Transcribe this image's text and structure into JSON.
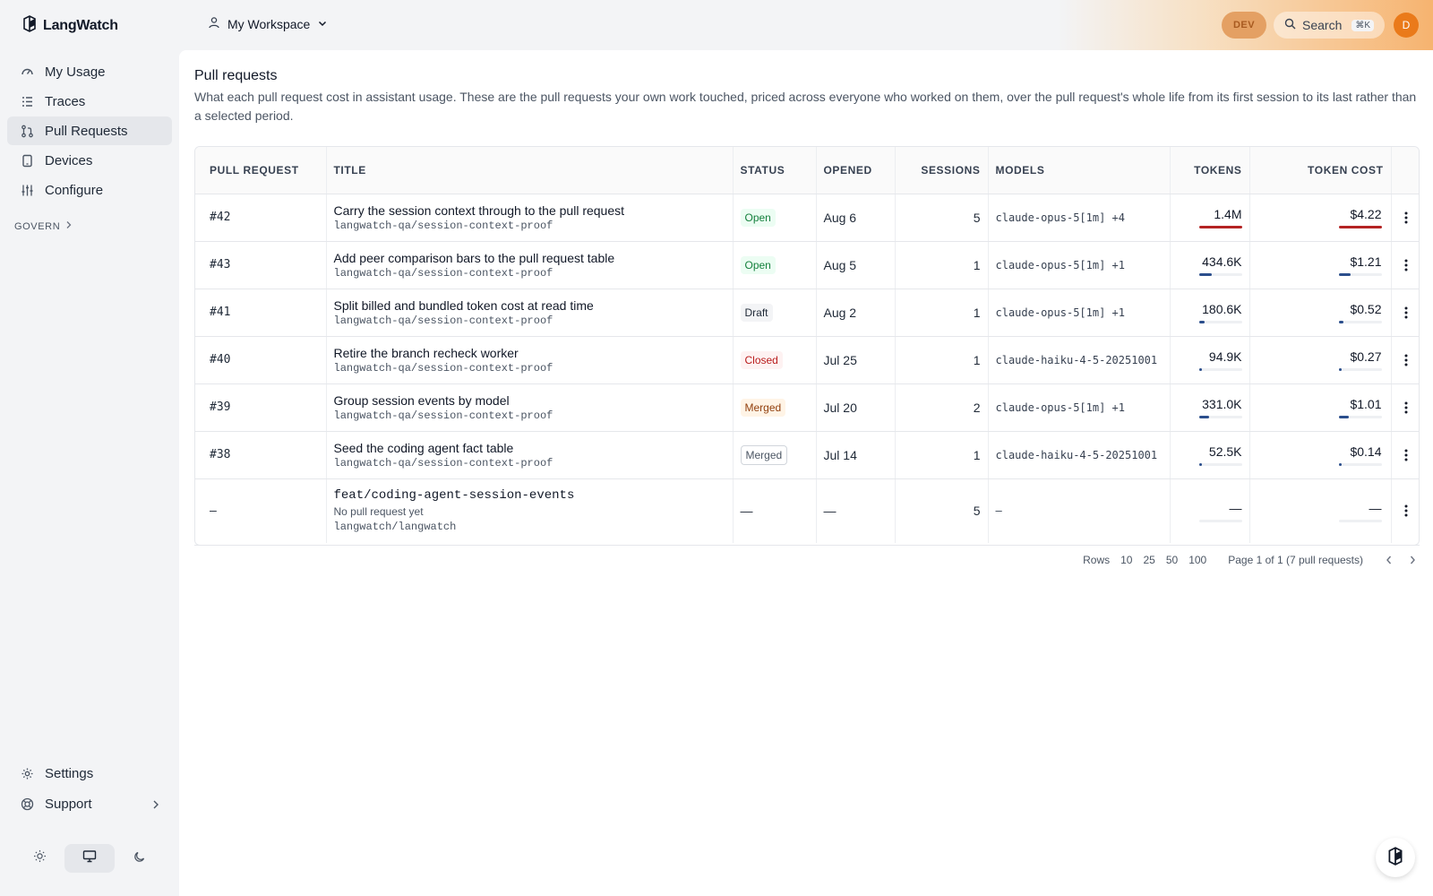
{
  "app": {
    "name": "LangWatch"
  },
  "header": {
    "workspace": "My Workspace",
    "env_badge": "DEV",
    "search_label": "Search",
    "search_shortcut": "⌘K",
    "avatar_initial": "D",
    "accent_color": "#f7a858"
  },
  "sidebar": {
    "items": [
      {
        "label": "My Usage",
        "icon": "gauge-icon"
      },
      {
        "label": "Traces",
        "icon": "list-icon"
      },
      {
        "label": "Pull Requests",
        "icon": "git-pull-request-icon",
        "active": true
      },
      {
        "label": "Devices",
        "icon": "tablet-icon"
      },
      {
        "label": "Configure",
        "icon": "sliders-icon"
      }
    ],
    "section": "GOVERN",
    "bottom": [
      {
        "label": "Settings",
        "icon": "gear-icon"
      },
      {
        "label": "Support",
        "icon": "lifebuoy-icon"
      }
    ]
  },
  "page": {
    "title": "Pull requests",
    "description": "What each pull request cost in assistant usage. These are the pull requests your own work touched, priced across everyone who worked on them, over the pull request's whole life from its first session to its last rather than a selected period."
  },
  "table": {
    "columns": [
      "PULL REQUEST",
      "TITLE",
      "STATUS",
      "OPENED",
      "SESSIONS",
      "MODELS",
      "TOKENS",
      "TOKEN COST"
    ],
    "rows": [
      {
        "pr": "#42",
        "title": "Carry the session context through to the pull request",
        "repo": "langwatch-qa/session-context-proof",
        "status": "Open",
        "opened": "Aug 6",
        "sessions": "5",
        "models": "claude-opus-5[1m] +4",
        "tokens": "1.4M",
        "tokens_frac": 1.0,
        "cost": "$4.22",
        "cost_frac": 1.0
      },
      {
        "pr": "#43",
        "title": "Add peer comparison bars to the pull request table",
        "repo": "langwatch-qa/session-context-proof",
        "status": "Open",
        "opened": "Aug 5",
        "sessions": "1",
        "models": "claude-opus-5[1m] +1",
        "tokens": "434.6K",
        "tokens_frac": 0.31,
        "cost": "$1.21",
        "cost_frac": 0.29
      },
      {
        "pr": "#41",
        "title": "Split billed and bundled token cost at read time",
        "repo": "langwatch-qa/session-context-proof",
        "status": "Draft",
        "opened": "Aug 2",
        "sessions": "1",
        "models": "claude-opus-5[1m] +1",
        "tokens": "180.6K",
        "tokens_frac": 0.13,
        "cost": "$0.52",
        "cost_frac": 0.12
      },
      {
        "pr": "#40",
        "title": "Retire the branch recheck worker",
        "repo": "langwatch-qa/session-context-proof",
        "status": "Closed",
        "opened": "Jul 25",
        "sessions": "1",
        "models": "claude-haiku-4-5-20251001",
        "tokens": "94.9K",
        "tokens_frac": 0.07,
        "cost": "$0.27",
        "cost_frac": 0.06
      },
      {
        "pr": "#39",
        "title": "Group session events by model",
        "repo": "langwatch-qa/session-context-proof",
        "status": "Merged",
        "opened": "Jul 20",
        "sessions": "2",
        "models": "claude-opus-5[1m] +1",
        "tokens": "331.0K",
        "tokens_frac": 0.24,
        "cost": "$1.01",
        "cost_frac": 0.24
      },
      {
        "pr": "#38",
        "title": "Seed the coding agent fact table",
        "repo": "langwatch-qa/session-context-proof",
        "status": "Merged",
        "opened": "Jul 14",
        "sessions": "1",
        "models": "claude-haiku-4-5-20251001",
        "tokens": "52.5K",
        "tokens_frac": 0.04,
        "cost": "$0.14",
        "cost_frac": 0.03
      },
      {
        "pr": "—",
        "title": "feat/coding-agent-session-events",
        "note": "No pull request yet",
        "repo": "langwatch/langwatch",
        "status": "—",
        "opened": "—",
        "sessions": "5",
        "models": "—",
        "tokens": "—",
        "tokens_frac": 0,
        "cost": "—",
        "cost_frac": 0
      }
    ]
  },
  "pagination": {
    "rows_label": "Rows",
    "options": [
      "10",
      "25",
      "50",
      "100"
    ],
    "summary": "Page 1 of 1 (7 pull requests)"
  },
  "colors": {
    "bar_top": "#b42323",
    "bar_default": "#2b4e8c",
    "active_nav": "#e5e7eb"
  }
}
